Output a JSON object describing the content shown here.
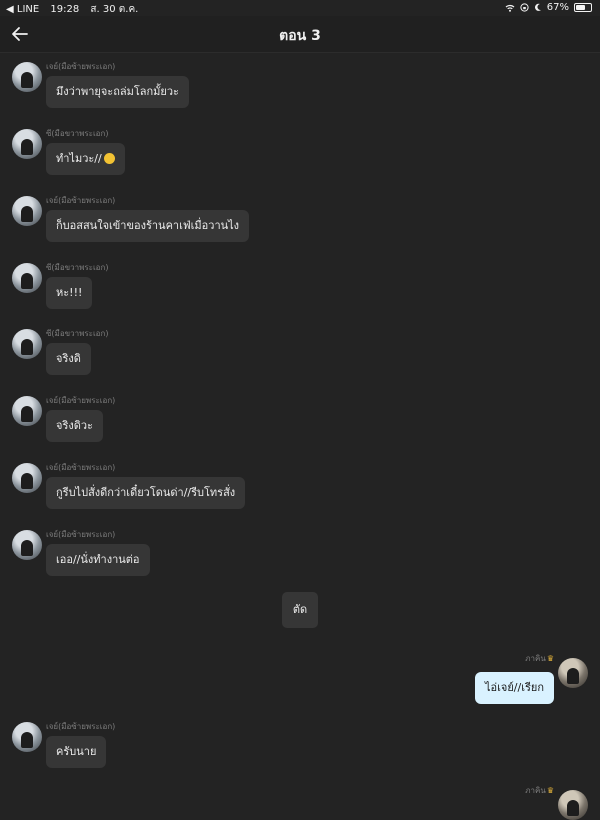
{
  "status_bar": {
    "back_app": "◀ LINE",
    "time": "19:28",
    "date": "ส. 30 ต.ค.",
    "battery": "67%",
    "battery_level": 0.67
  },
  "header": {
    "title": "ตอน 3"
  },
  "messages": [
    {
      "side": "left",
      "name": "เจย์(มือซ้ายพระเอก)",
      "text": "มึงว่าพายุจะถล่มโลกมั้ยวะ"
    },
    {
      "side": "left",
      "name": "ซี(มือขวาพระเอก)",
      "text": "ทำไมวะ//",
      "emoji": "pouting-face"
    },
    {
      "side": "left",
      "name": "เจย์(มือซ้ายพระเอก)",
      "text": "ก็บอสสนใจเข้าของร้านคาเฟ่เมื่อวานไง"
    },
    {
      "side": "left",
      "name": "ซี(มือขวาพระเอก)",
      "text": "หะ!!!"
    },
    {
      "side": "left",
      "name": "ซี(มือขวาพระเอก)",
      "text": "จริงดิ"
    },
    {
      "side": "left",
      "name": "เจย์(มือซ้ายพระเอก)",
      "text": "จริงดิวะ"
    },
    {
      "side": "left",
      "name": "เจย์(มือซ้ายพระเอก)",
      "text": "กูรีบไปสั่งดีกว่าเดี๋ยวโดนด่า//รีบโทรสั่ง"
    },
    {
      "side": "left",
      "name": "เจย์(มือซ้ายพระเอก)",
      "text": "เออ//นั่งทำงานต่อ"
    },
    {
      "side": "right",
      "name": "ภาคิน",
      "text": "ไอ่เจย์//เรียก"
    },
    {
      "side": "left",
      "name": "เจย์(มือซ้ายพระเอก)",
      "text": "ครับนาย"
    },
    {
      "side": "right",
      "name": "ภาคิน",
      "text": ""
    }
  ],
  "cut_label": "ตัด",
  "colors": {
    "background": "#232323",
    "bubble_left": "#363636",
    "bubble_right": "#d9f2ff",
    "crown": "#e2b23b"
  }
}
